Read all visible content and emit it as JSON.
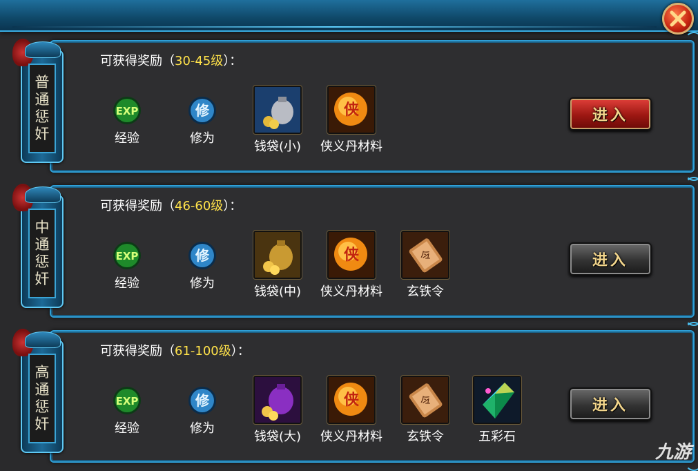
{
  "header": {
    "close_icon": "close-x-icon"
  },
  "panels": [
    {
      "banner": [
        "普",
        "通",
        "惩",
        "奸"
      ],
      "reward_prefix": "可获得奖励（",
      "level_range": "30-45级",
      "reward_suffix": "）：",
      "items": [
        {
          "label": "经验",
          "icon": "exp-icon"
        },
        {
          "label": "修为",
          "icon": "cultivation-icon"
        },
        {
          "label": "钱袋(小)",
          "icon": "money-bag-small-icon"
        },
        {
          "label": "侠义丹材料",
          "icon": "xiayi-pill-material-icon"
        }
      ],
      "button_label": "进入",
      "button_style": "red"
    },
    {
      "banner": [
        "中",
        "通",
        "惩",
        "奸"
      ],
      "reward_prefix": "可获得奖励（",
      "level_range": "46-60级",
      "reward_suffix": "）：",
      "items": [
        {
          "label": "经验",
          "icon": "exp-icon"
        },
        {
          "label": "修为",
          "icon": "cultivation-icon"
        },
        {
          "label": "钱袋(中)",
          "icon": "money-bag-medium-icon"
        },
        {
          "label": "侠义丹材料",
          "icon": "xiayi-pill-material-icon"
        },
        {
          "label": "玄铁令",
          "icon": "iron-token-icon"
        }
      ],
      "button_label": "进入",
      "button_style": "dark"
    },
    {
      "banner": [
        "高",
        "通",
        "惩",
        "奸"
      ],
      "reward_prefix": "可获得奖励（",
      "level_range": "61-100级",
      "reward_suffix": "）：",
      "items": [
        {
          "label": "经验",
          "icon": "exp-icon"
        },
        {
          "label": "修为",
          "icon": "cultivation-icon"
        },
        {
          "label": "钱袋(大)",
          "icon": "money-bag-large-icon"
        },
        {
          "label": "侠义丹材料",
          "icon": "xiayi-pill-material-icon"
        },
        {
          "label": "玄铁令",
          "icon": "iron-token-icon"
        },
        {
          "label": "五彩石",
          "icon": "five-color-stone-icon"
        }
      ],
      "button_label": "进入",
      "button_style": "dark"
    }
  ],
  "watermark": "九游",
  "colors": {
    "level_text": "#ffe24a",
    "frame_blue": "#2f9fd6",
    "button_red": "#c62410"
  }
}
